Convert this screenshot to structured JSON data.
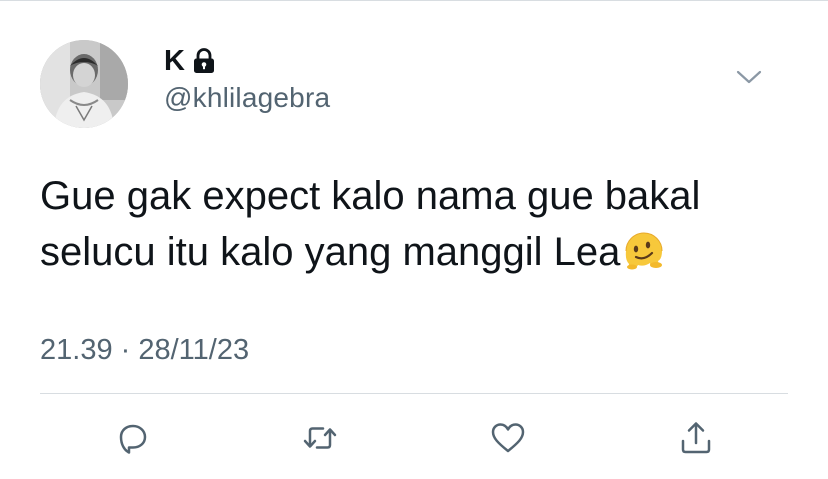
{
  "profile": {
    "display_name": "K",
    "handle": "@khlilagebra",
    "protected": true
  },
  "tweet": {
    "text": "Gue gak expect kalo nama gue bakal selucu itu kalo yang manggil Lea",
    "line1": "Gue gak expect kalo nama gue bakal",
    "line2": "selucu itu kalo yang manggil Lea",
    "emoji": "melting-face"
  },
  "meta": {
    "timestamp": "21.39 · 28/11/23"
  },
  "icons": {
    "lock": "lock-icon",
    "chevron": "chevron-down-icon",
    "reply": "reply-icon",
    "retweet": "retweet-icon",
    "like": "heart-icon",
    "share": "share-icon"
  },
  "colors": {
    "text_primary": "#0f1419",
    "text_secondary": "#536471",
    "divider": "#d8dde1",
    "icon": "#536471"
  }
}
